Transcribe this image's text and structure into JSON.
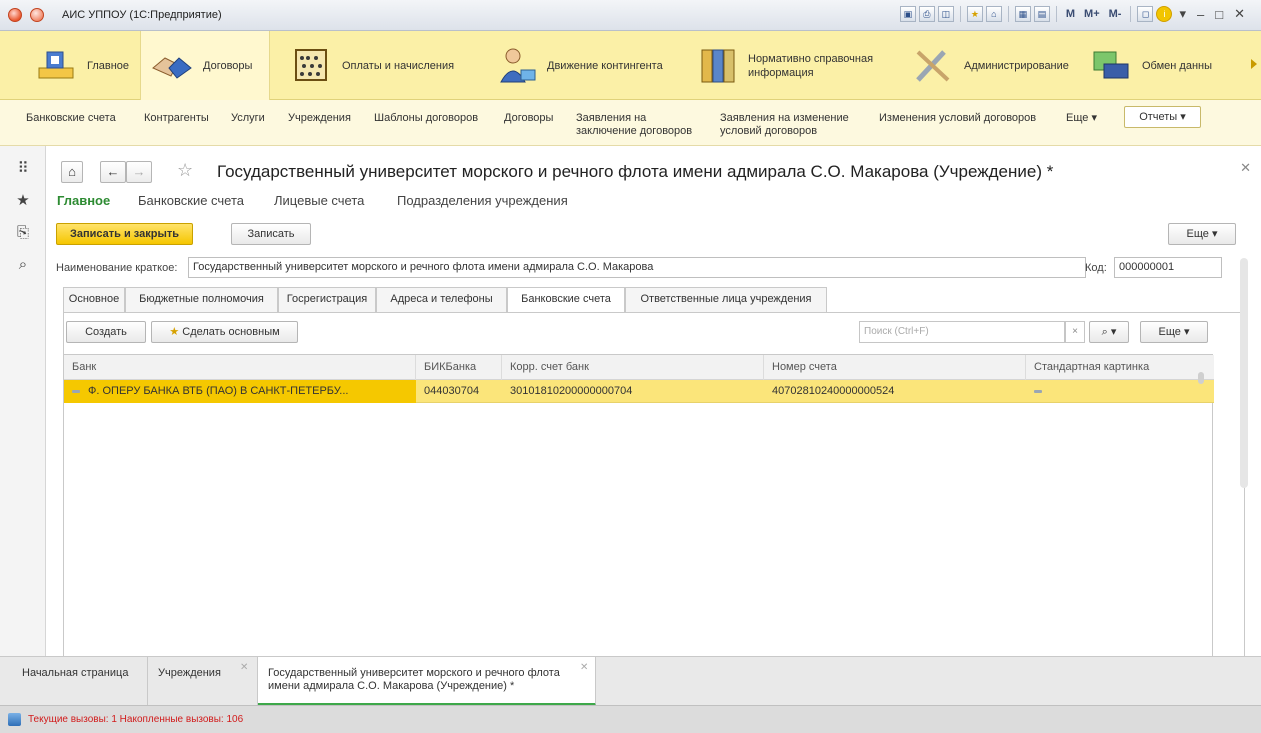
{
  "window": {
    "title": "АИС УППОУ (1С:Предприятие)"
  },
  "toolbar_icons": [
    "save-icon",
    "print-icon",
    "preview-icon",
    "favorite-icon",
    "bookmark-icon",
    "calculator-icon",
    "calendar-icon"
  ],
  "memory_buttons": {
    "m": "M",
    "m_plus": "M+",
    "m_minus": "M-"
  },
  "sections": [
    {
      "label": "Главное",
      "icon": "house-icon"
    },
    {
      "label": "Договоры",
      "icon": "handshake-icon"
    },
    {
      "label": "Оплаты и начисления",
      "icon": "abacus-icon"
    },
    {
      "label": "Движение контингента",
      "icon": "person-icon"
    },
    {
      "label": "Нормативно справочная информация",
      "icon": "binders-icon"
    },
    {
      "label": "Администрирование",
      "icon": "tools-icon"
    },
    {
      "label": "Обмен данны",
      "icon": "exchange-icon"
    }
  ],
  "funcbar": {
    "items": [
      "Банковские счета",
      "Контрагенты",
      "Услуги",
      "Учреждения",
      "Шаблоны договоров",
      "Договоры",
      "Заявления на заключение договоров",
      "Заявления на изменение условий договоров",
      "Изменения условий договоров",
      "Еще ▾"
    ],
    "reports": "Отчеты ▾"
  },
  "form": {
    "title": "Государственный университет морского и речного флота имени адмирала С.О. Макарова (Учреждение) *",
    "tabs": [
      "Главное",
      "Банковские счета",
      "Лицевые счета",
      "Подразделения учреждения"
    ],
    "save_close": "Записать и закрыть",
    "save": "Записать",
    "more": "Еще",
    "short_name_label": "Наименование краткое:",
    "short_name_value": "Государственный университет морского и речного флота имени адмирала С.О. Макарова",
    "code_label": "Код:",
    "code_value": "000000001",
    "inner_tabs": [
      "Основное",
      "Бюджетные полномочия",
      "Госрегистрация",
      "Адреса и телефоны",
      "Банковские счета",
      "Ответственные лица учреждения"
    ],
    "create": "Создать",
    "make_main": "Сделать основным",
    "search_placeholder": "Поиск (Ctrl+F)",
    "search_clear": "×",
    "grid_more": "Еще",
    "columns": [
      "Банк",
      "БИКБанка",
      "Корр. счет банк",
      "Номер счета",
      "Стандартная картинка"
    ],
    "rows": [
      {
        "bank": "Ф. ОПЕРУ БАНКА ВТБ (ПАО) В САНКТ-ПЕТЕРБУ...",
        "bik": "044030704",
        "corr": "30101810200000000704",
        "account": "40702810240000000524"
      }
    ]
  },
  "window_tabs": [
    {
      "label": "Начальная страница"
    },
    {
      "label": "Учреждения"
    },
    {
      "label": "Государственный университет морского и речного флота имени адмирала С.О. Макарова (Учреждение) *"
    }
  ],
  "status": "Текущие вызовы: 1   Накопленные вызовы: 106"
}
